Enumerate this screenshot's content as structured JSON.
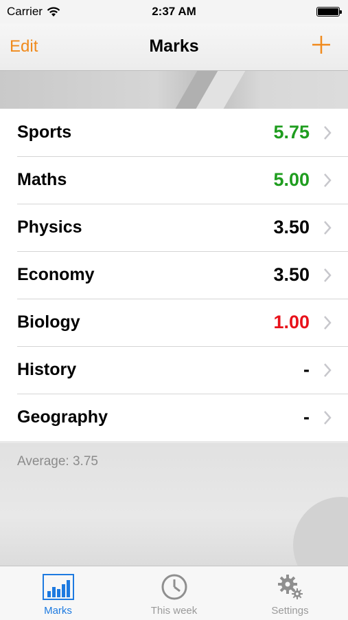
{
  "status_bar": {
    "carrier": "Carrier",
    "time": "2:37 AM"
  },
  "nav": {
    "edit_label": "Edit",
    "title": "Marks",
    "add_icon": "plus-icon"
  },
  "subjects": [
    {
      "name": "Sports",
      "mark": "5.75",
      "color": "#1f9d1f"
    },
    {
      "name": "Maths",
      "mark": "5.00",
      "color": "#1f9d1f"
    },
    {
      "name": "Physics",
      "mark": "3.50",
      "color": "#000000"
    },
    {
      "name": "Economy",
      "mark": "3.50",
      "color": "#000000"
    },
    {
      "name": "Biology",
      "mark": "1.00",
      "color": "#e8121b"
    },
    {
      "name": "History",
      "mark": "-",
      "color": "#000000"
    },
    {
      "name": "Geography",
      "mark": "-",
      "color": "#000000"
    }
  ],
  "average": "Average: 3.75",
  "tabs": [
    {
      "label": "Marks",
      "icon": "bar-chart-icon",
      "active": true
    },
    {
      "label": "This week",
      "icon": "clock-icon",
      "active": false
    },
    {
      "label": "Settings",
      "icon": "gears-icon",
      "active": false
    }
  ],
  "colors": {
    "accent": "#f08a1c",
    "active_tab": "#1d7ae0"
  }
}
